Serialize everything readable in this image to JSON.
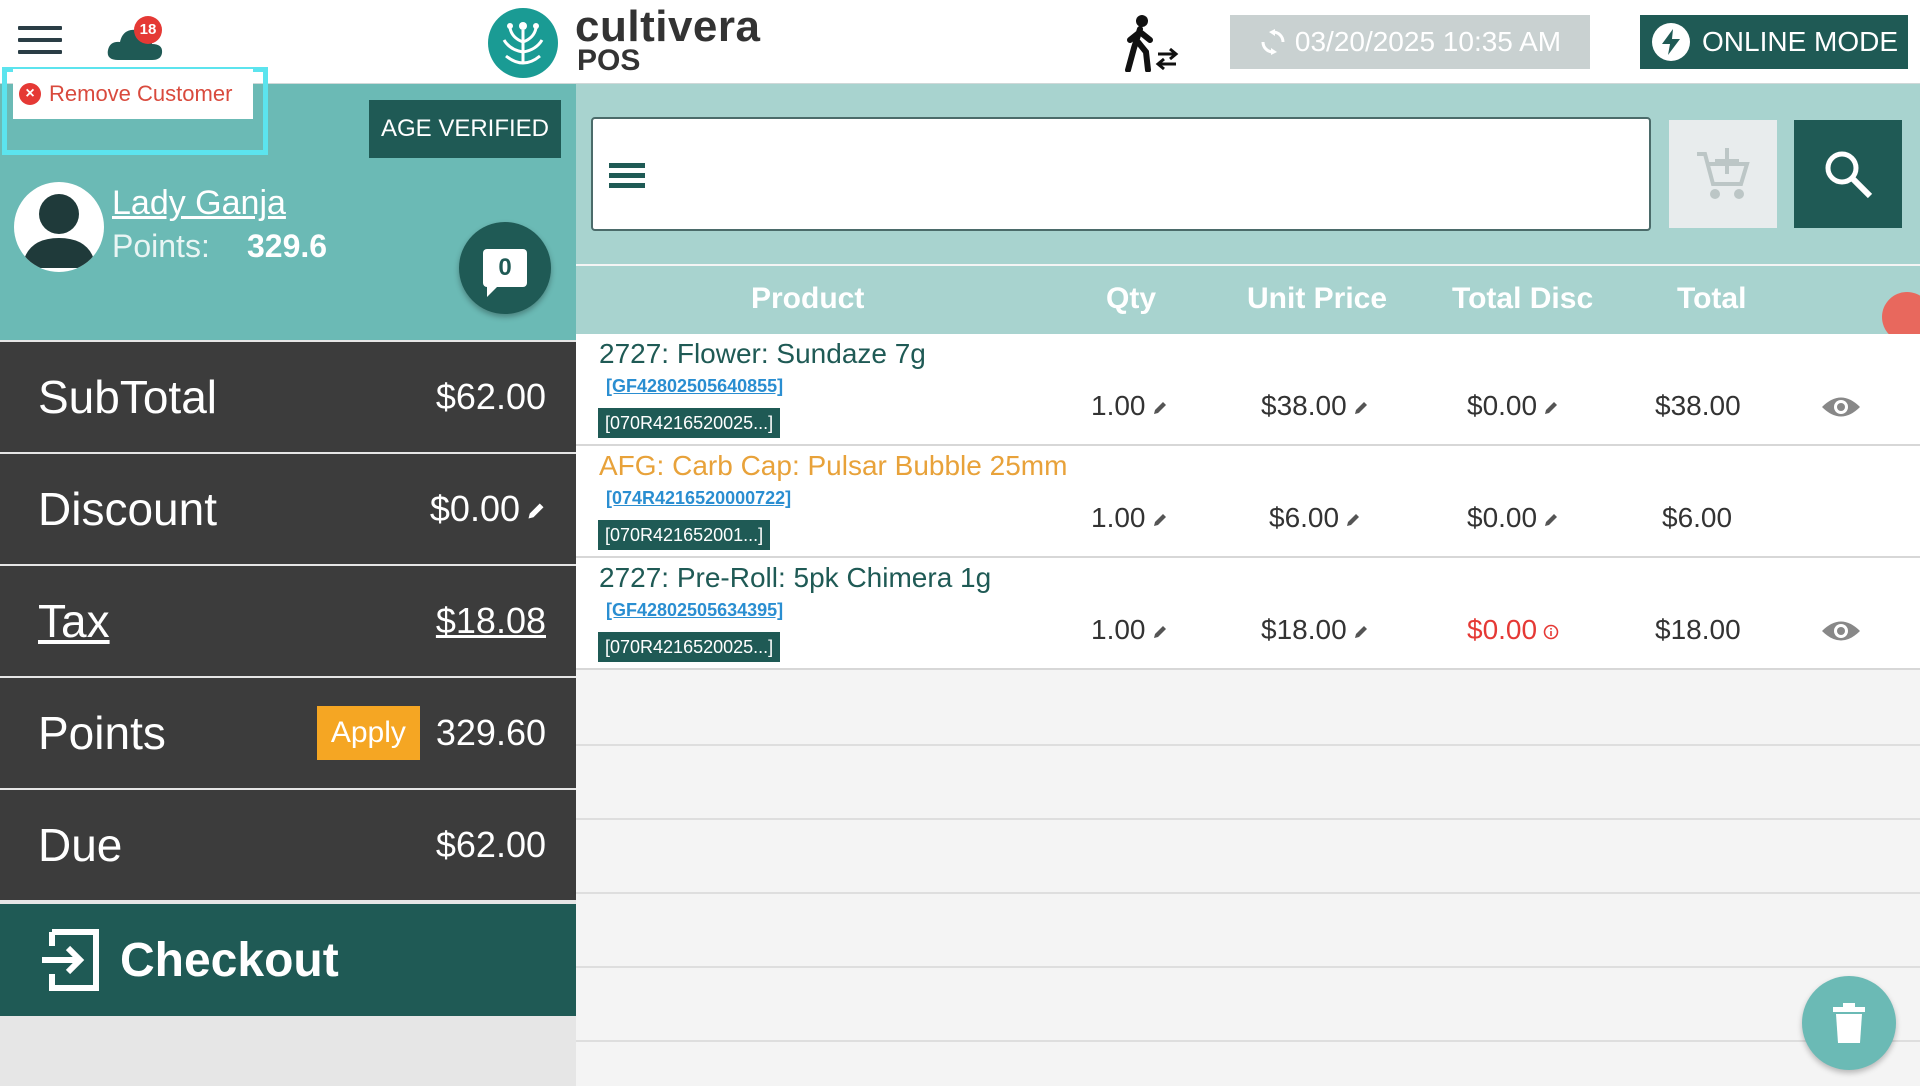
{
  "header": {
    "notification_count": "18",
    "logo_name": "cultivera",
    "logo_sub": "POS",
    "datetime": "03/20/2025 10:35 AM",
    "online_label": "ONLINE MODE"
  },
  "customer": {
    "remove_label": "Remove Customer",
    "age_verified_label": "AGE VERIFIED",
    "name": "Lady Ganja",
    "points_label": "Points:",
    "points_value": "329.6",
    "notes_count": "0"
  },
  "summary": {
    "subtotal_label": "SubTotal",
    "subtotal_value": "$62.00",
    "discount_label": "Discount",
    "discount_value": "$0.00",
    "tax_label": "Tax",
    "tax_value": "$18.08",
    "points_label": "Points",
    "apply_label": "Apply",
    "points_value": "329.60",
    "due_label": "Due",
    "due_value": "$62.00",
    "checkout_label": "Checkout"
  },
  "table": {
    "headers": {
      "product": "Product",
      "qty": "Qty",
      "unit_price": "Unit Price",
      "total_disc": "Total Disc",
      "total": "Total"
    },
    "rows": [
      {
        "name": "2727: Flower: Sundaze 7g",
        "sku": "[GF42802505640855]",
        "tag": "[070R4216520025...]",
        "qty": "1.00",
        "unit_price": "$38.00",
        "total_disc": "$0.00",
        "total": "$38.00"
      },
      {
        "name": "AFG: Carb Cap: Pulsar Bubble 25mm",
        "sku": "[074R4216520000722]",
        "tag": "[070R421652001...]",
        "qty": "1.00",
        "unit_price": "$6.00",
        "total_disc": "$0.00",
        "total": "$6.00"
      },
      {
        "name": "2727: Pre-Roll: 5pk Chimera 1g",
        "sku": "[GF42802505634395]",
        "tag": "[070R4216520025...]",
        "qty": "1.00",
        "unit_price": "$18.00",
        "total_disc": "$0.00",
        "total": "$18.00"
      }
    ]
  },
  "colors": {
    "primary_dark": "#1f5a55",
    "teal": "#6bbab5",
    "panel_dark": "#3c3c3c",
    "accent_orange": "#f5a623",
    "danger": "#e53935"
  }
}
